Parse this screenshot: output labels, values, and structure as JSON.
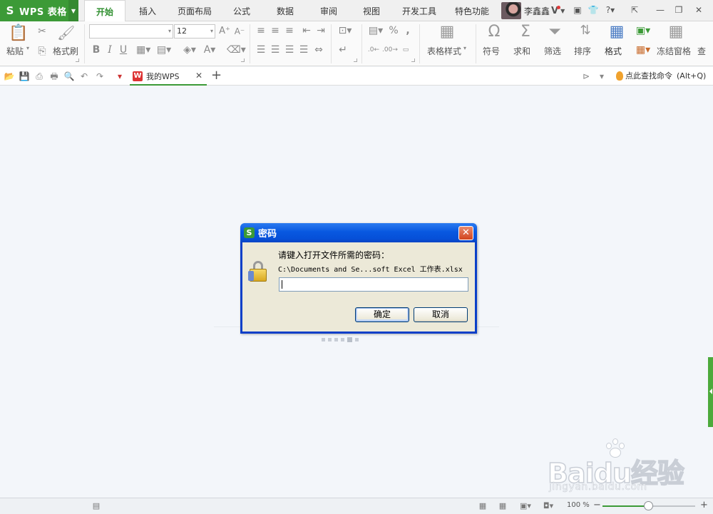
{
  "app": {
    "name": "WPS 表格",
    "logo_glyph": "S"
  },
  "menu_tabs": [
    {
      "label": "开始",
      "active": true
    },
    {
      "label": "插入"
    },
    {
      "label": "页面布局"
    },
    {
      "label": "公式"
    },
    {
      "label": "数据"
    },
    {
      "label": "审阅"
    },
    {
      "label": "视图"
    },
    {
      "label": "开发工具"
    },
    {
      "label": "特色功能"
    }
  ],
  "user": {
    "name": "李鑫鑫",
    "badge": "V"
  },
  "ribbon": {
    "paste": "粘贴",
    "format_painter": "格式刷",
    "font_name": "",
    "font_size": "12",
    "bold": "B",
    "italic": "I",
    "underline": "U",
    "table_style": "表格样式",
    "symbol": "符号",
    "sum": "求和",
    "filter": "筛选",
    "sort": "排序",
    "format": "格式",
    "freeze": "冻结窗格",
    "percent": "%",
    "comma": ","
  },
  "document_tab": {
    "logo": "W",
    "name": "我的WPS"
  },
  "command_search": {
    "label": "点此查找命令",
    "shortcut": "(Alt+Q)"
  },
  "dialog": {
    "title": "密码",
    "prompt": "请键入打开文件所需的密码：",
    "path": "C:\\Documents and Se...soft Excel 工作表.xlsx",
    "password_value": "",
    "ok_label": "确定",
    "cancel_label": "取消"
  },
  "statusbar": {
    "zoom_label": "100 %",
    "zoom_level": 0.5
  },
  "watermark": {
    "brand": "Baidu经验",
    "url": "jingyan.baidu.com"
  },
  "colors": {
    "accent": "#3c9a37",
    "xp_title": "#0858e0",
    "xp_face": "#ece9d8"
  }
}
